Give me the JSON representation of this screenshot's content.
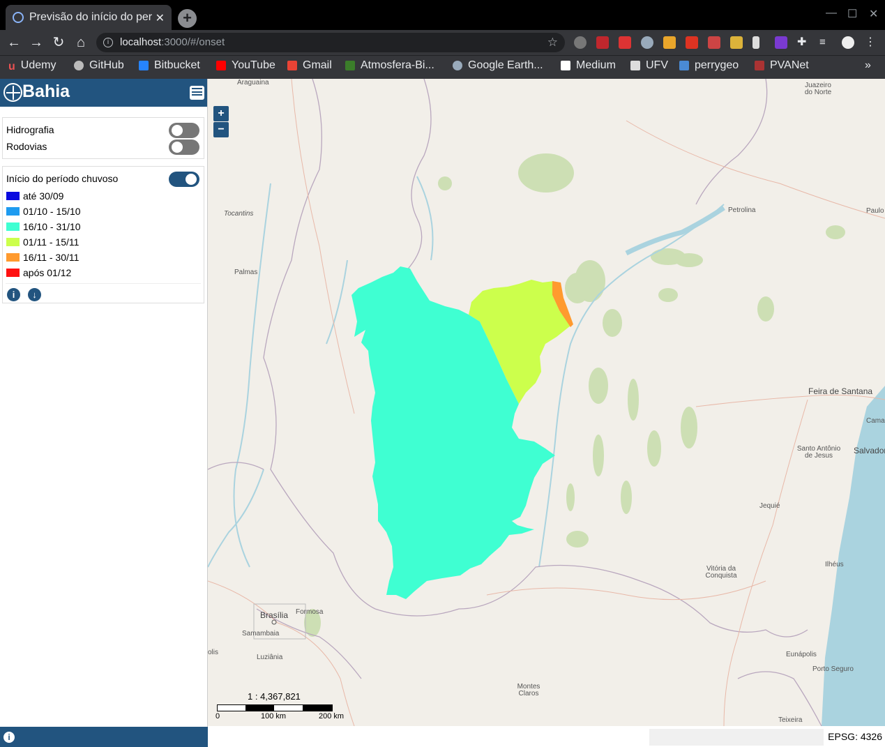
{
  "browser": {
    "tab_title": "Previsão do início do período chuvoso",
    "url_host": "localhost",
    "url_path": ":3000/#/onset",
    "bookmarks": [
      "Udemy",
      "GitHub",
      "Bitbucket",
      "YouTube",
      "Gmail",
      "Atmosfera-Bi...",
      "Google Earth...",
      "Medium",
      "UFV",
      "perrygeo",
      "PVANet"
    ]
  },
  "sidebar": {
    "logo": "Bahia",
    "layers": [
      {
        "label": "Hidrografia",
        "on": false
      },
      {
        "label": "Rodovias",
        "on": false
      }
    ],
    "legend": {
      "title": "Início do período chuvoso",
      "on": true,
      "items": [
        {
          "label": "até 30/09",
          "color": "#0a0adf"
        },
        {
          "label": "01/10 - 15/10",
          "color": "#1e9bf0"
        },
        {
          "label": "16/10 - 31/10",
          "color": "#3fffd2"
        },
        {
          "label": "01/11 - 15/11",
          "color": "#ccff4c"
        },
        {
          "label": "16/11 - 30/11",
          "color": "#ff9a2e"
        },
        {
          "label": "após 01/12",
          "color": "#ff1111"
        }
      ]
    }
  },
  "map": {
    "zoom_in": "+",
    "zoom_out": "−",
    "places": [
      "Araguaina",
      "Juazeiro do Norte",
      "Tocantins",
      "Petrolina",
      "Paulo",
      "Palmas",
      "Feira de Santana",
      "Cama",
      "Santo Antônio de Jesus",
      "Salvador",
      "Jequié",
      "Ilhéus",
      "Vitória da Conquista",
      "Brasília",
      "Formosa",
      "Samambaia",
      "olis",
      "Luziânia",
      "Eunápolis",
      "Porto Seguro",
      "Montes Claros",
      "Teixeira"
    ],
    "scale_ratio": "1 : 4,367,821",
    "scale_ticks": [
      "0",
      "100 km",
      "200 km"
    ]
  },
  "status": {
    "epsg": "EPSG: 4326"
  }
}
